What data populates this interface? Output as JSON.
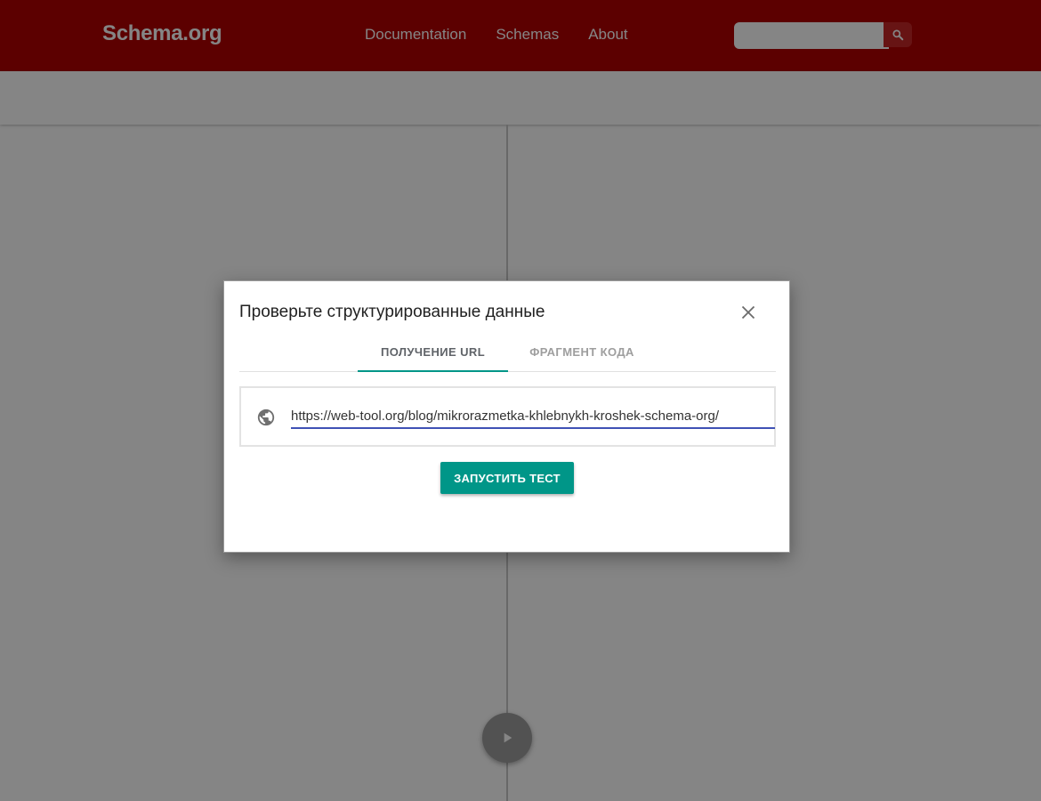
{
  "header": {
    "logo": "Schema.org",
    "nav": [
      "Documentation",
      "Schemas",
      "About"
    ],
    "search_placeholder": "",
    "search_icon": "search-icon"
  },
  "dialog": {
    "title": "Проверьте структурированные данные",
    "close_icon": "close-icon",
    "tabs": [
      {
        "label": "ПОЛУЧЕНИЕ URL",
        "active": true
      },
      {
        "label": "ФРАГМЕНТ КОДА",
        "active": false
      }
    ],
    "url_icon": "globe-icon",
    "url_value": "https://web-tool.org/blog/mikrorazmetka-khlebnykh-kroshek-schema-org/",
    "run_button": "ЗАПУСТИТЬ ТЕСТ"
  },
  "colors": {
    "header_bg": "#b00000",
    "accent": "#009688",
    "input_underline": "#3f51b5"
  },
  "fab_icon": "play-icon"
}
